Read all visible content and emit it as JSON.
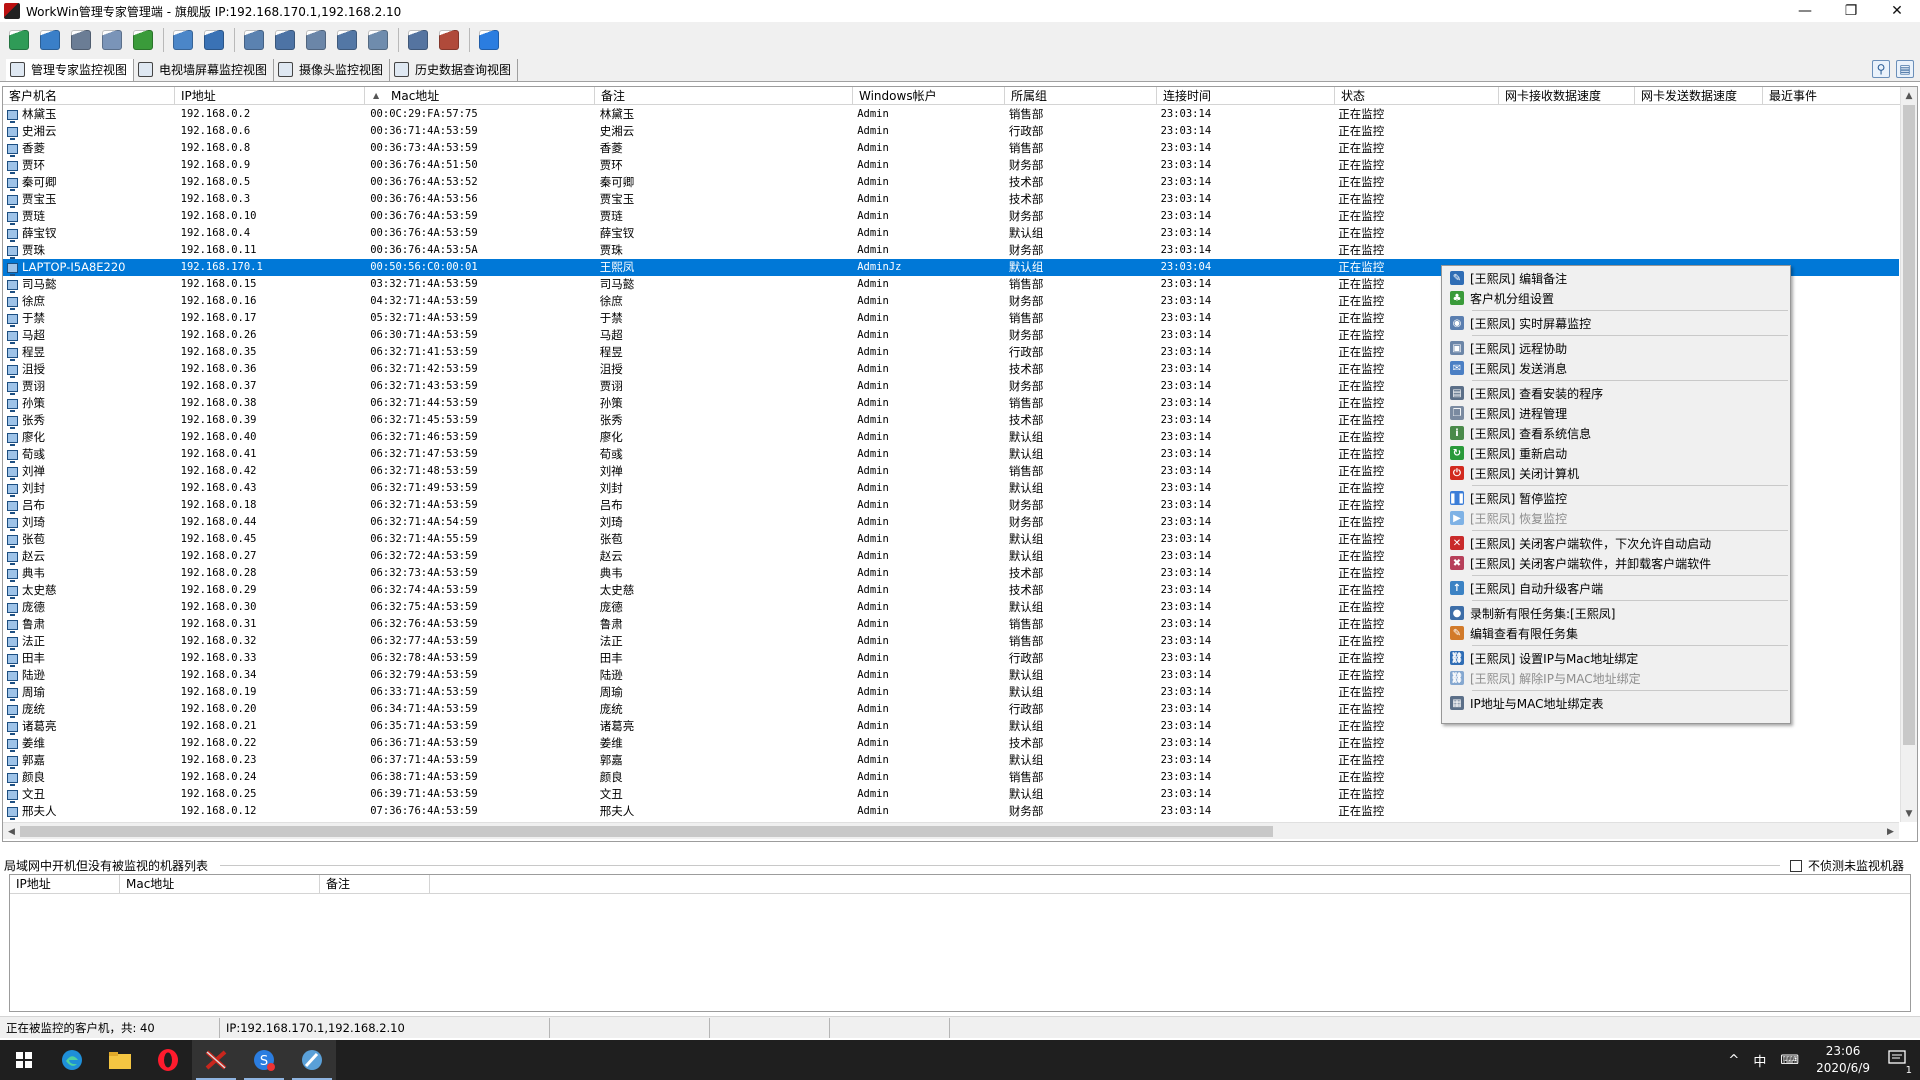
{
  "window": {
    "title": "WorkWin管理专家管理端 - 旗舰版 IP:192.168.170.1,192.168.2.10",
    "minimize": "—",
    "maximize": "❐",
    "close": "✕"
  },
  "toolbar": {
    "icons": [
      "refresh-icon",
      "globe-icon",
      "screen-monitor-icon",
      "remote-desktop-icon",
      "send-message-icon",
      "user-group-icon",
      "policy-icon",
      "multi-screen-icon",
      "process-icon",
      "camera-icon",
      "history-icon",
      "search-log-icon",
      "window-icon",
      "settings-icon",
      "help-icon"
    ]
  },
  "tabs": [
    {
      "label": "管理专家监控视图"
    },
    {
      "label": "电视墙屏幕监控视图"
    },
    {
      "label": "摄像头监控视图"
    },
    {
      "label": "历史数据查询视图"
    }
  ],
  "tab_right": {
    "search": "⚲",
    "layout": "▤"
  },
  "main_grid": {
    "columns": [
      "客户机名",
      "IP地址",
      "Mac地址",
      "备注",
      "Windows帐户",
      "所属组",
      "连接时间",
      "状态",
      "网卡接收数据速度",
      "网卡发送数据速度",
      "最近事件"
    ],
    "rows": [
      [
        "林黛玉",
        "192.168.0.2",
        "00:0C:29:FA:57:75",
        "林黛玉",
        "Admin",
        "销售部",
        "23:03:14",
        "正在监控"
      ],
      [
        "史湘云",
        "192.168.0.6",
        "00:36:71:4A:53:59",
        "史湘云",
        "Admin",
        "行政部",
        "23:03:14",
        "正在监控"
      ],
      [
        "香菱",
        "192.168.0.8",
        "00:36:73:4A:53:59",
        "香菱",
        "Admin",
        "销售部",
        "23:03:14",
        "正在监控"
      ],
      [
        "贾环",
        "192.168.0.9",
        "00:36:76:4A:51:50",
        "贾环",
        "Admin",
        "财务部",
        "23:03:14",
        "正在监控"
      ],
      [
        "秦可卿",
        "192.168.0.5",
        "00:36:76:4A:53:52",
        "秦可卿",
        "Admin",
        "技术部",
        "23:03:14",
        "正在监控"
      ],
      [
        "贾宝玉",
        "192.168.0.3",
        "00:36:76:4A:53:56",
        "贾宝玉",
        "Admin",
        "技术部",
        "23:03:14",
        "正在监控"
      ],
      [
        "贾琏",
        "192.168.0.10",
        "00:36:76:4A:53:59",
        "贾琏",
        "Admin",
        "财务部",
        "23:03:14",
        "正在监控"
      ],
      [
        "薛宝钗",
        "192.168.0.4",
        "00:36:76:4A:53:59",
        "薛宝钗",
        "Admin",
        "默认组",
        "23:03:14",
        "正在监控"
      ],
      [
        "贾珠",
        "192.168.0.11",
        "00:36:76:4A:53:5A",
        "贾珠",
        "Admin",
        "财务部",
        "23:03:14",
        "正在监控"
      ],
      [
        "LAPTOP-I5A8E220",
        "192.168.170.1",
        "00:50:56:C0:00:01",
        "王熙凤",
        "AdminJz",
        "默认组",
        "23:03:04",
        "正在监控"
      ],
      [
        "司马懿",
        "192.168.0.15",
        "03:32:71:4A:53:59",
        "司马懿",
        "Admin",
        "销售部",
        "23:03:14",
        "正在监控"
      ],
      [
        "徐庶",
        "192.168.0.16",
        "04:32:71:4A:53:59",
        "徐庶",
        "Admin",
        "财务部",
        "23:03:14",
        "正在监控"
      ],
      [
        "于禁",
        "192.168.0.17",
        "05:32:71:4A:53:59",
        "于禁",
        "Admin",
        "销售部",
        "23:03:14",
        "正在监控"
      ],
      [
        "马超",
        "192.168.0.26",
        "06:30:71:4A:53:59",
        "马超",
        "Admin",
        "财务部",
        "23:03:14",
        "正在监控"
      ],
      [
        "程昱",
        "192.168.0.35",
        "06:32:71:41:53:59",
        "程昱",
        "Admin",
        "行政部",
        "23:03:14",
        "正在监控"
      ],
      [
        "沮授",
        "192.168.0.36",
        "06:32:71:42:53:59",
        "沮授",
        "Admin",
        "技术部",
        "23:03:14",
        "正在监控"
      ],
      [
        "贾诩",
        "192.168.0.37",
        "06:32:71:43:53:59",
        "贾诩",
        "Admin",
        "财务部",
        "23:03:14",
        "正在监控"
      ],
      [
        "孙策",
        "192.168.0.38",
        "06:32:71:44:53:59",
        "孙策",
        "Admin",
        "销售部",
        "23:03:14",
        "正在监控"
      ],
      [
        "张秀",
        "192.168.0.39",
        "06:32:71:45:53:59",
        "张秀",
        "Admin",
        "技术部",
        "23:03:14",
        "正在监控"
      ],
      [
        "廖化",
        "192.168.0.40",
        "06:32:71:46:53:59",
        "廖化",
        "Admin",
        "默认组",
        "23:03:14",
        "正在监控"
      ],
      [
        "荀彧",
        "192.168.0.41",
        "06:32:71:47:53:59",
        "荀彧",
        "Admin",
        "默认组",
        "23:03:14",
        "正在监控"
      ],
      [
        "刘禅",
        "192.168.0.42",
        "06:32:71:48:53:59",
        "刘禅",
        "Admin",
        "销售部",
        "23:03:14",
        "正在监控"
      ],
      [
        "刘封",
        "192.168.0.43",
        "06:32:71:49:53:59",
        "刘封",
        "Admin",
        "默认组",
        "23:03:14",
        "正在监控"
      ],
      [
        "吕布",
        "192.168.0.18",
        "06:32:71:4A:53:59",
        "吕布",
        "Admin",
        "财务部",
        "23:03:14",
        "正在监控"
      ],
      [
        "刘琦",
        "192.168.0.44",
        "06:32:71:4A:54:59",
        "刘琦",
        "Admin",
        "财务部",
        "23:03:14",
        "正在监控"
      ],
      [
        "张苞",
        "192.168.0.45",
        "06:32:71:4A:55:59",
        "张苞",
        "Admin",
        "默认组",
        "23:03:14",
        "正在监控"
      ],
      [
        "赵云",
        "192.168.0.27",
        "06:32:72:4A:53:59",
        "赵云",
        "Admin",
        "默认组",
        "23:03:14",
        "正在监控"
      ],
      [
        "典韦",
        "192.168.0.28",
        "06:32:73:4A:53:59",
        "典韦",
        "Admin",
        "技术部",
        "23:03:14",
        "正在监控"
      ],
      [
        "太史慈",
        "192.168.0.29",
        "06:32:74:4A:53:59",
        "太史慈",
        "Admin",
        "技术部",
        "23:03:14",
        "正在监控"
      ],
      [
        "庞德",
        "192.168.0.30",
        "06:32:75:4A:53:59",
        "庞德",
        "Admin",
        "默认组",
        "23:03:14",
        "正在监控"
      ],
      [
        "鲁肃",
        "192.168.0.31",
        "06:32:76:4A:53:59",
        "鲁肃",
        "Admin",
        "销售部",
        "23:03:14",
        "正在监控"
      ],
      [
        "法正",
        "192.168.0.32",
        "06:32:77:4A:53:59",
        "法正",
        "Admin",
        "销售部",
        "23:03:14",
        "正在监控"
      ],
      [
        "田丰",
        "192.168.0.33",
        "06:32:78:4A:53:59",
        "田丰",
        "Admin",
        "行政部",
        "23:03:14",
        "正在监控"
      ],
      [
        "陆逊",
        "192.168.0.34",
        "06:32:79:4A:53:59",
        "陆逊",
        "Admin",
        "默认组",
        "23:03:14",
        "正在监控"
      ],
      [
        "周瑜",
        "192.168.0.19",
        "06:33:71:4A:53:59",
        "周瑜",
        "Admin",
        "默认组",
        "23:03:14",
        "正在监控"
      ],
      [
        "庞统",
        "192.168.0.20",
        "06:34:71:4A:53:59",
        "庞统",
        "Admin",
        "行政部",
        "23:03:14",
        "正在监控"
      ],
      [
        "诸葛亮",
        "192.168.0.21",
        "06:35:71:4A:53:59",
        "诸葛亮",
        "Admin",
        "默认组",
        "23:03:14",
        "正在监控"
      ],
      [
        "姜维",
        "192.168.0.22",
        "06:36:71:4A:53:59",
        "姜维",
        "Admin",
        "技术部",
        "23:03:14",
        "正在监控"
      ],
      [
        "郭嘉",
        "192.168.0.23",
        "06:37:71:4A:53:59",
        "郭嘉",
        "Admin",
        "默认组",
        "23:03:14",
        "正在监控"
      ],
      [
        "颜良",
        "192.168.0.24",
        "06:38:71:4A:53:59",
        "颜良",
        "Admin",
        "销售部",
        "23:03:14",
        "正在监控"
      ],
      [
        "文丑",
        "192.168.0.25",
        "06:39:71:4A:53:59",
        "文丑",
        "Admin",
        "默认组",
        "23:03:14",
        "正在监控"
      ],
      [
        "邢夫人",
        "192.168.0.12",
        "07:36:76:4A:53:59",
        "邢夫人",
        "Admin",
        "财务部",
        "23:03:14",
        "正在监控"
      ]
    ],
    "selected_index": 9,
    "scroll_up": "▲",
    "scroll_down": "▼",
    "scroll_left": "◀",
    "scroll_right": "▶"
  },
  "context_menu": [
    {
      "label": "[王熙凤] 编辑备注",
      "icon": "edit-note-icon",
      "color": "#2f6db5",
      "glyph": "✎"
    },
    {
      "label": "客户机分组设置",
      "icon": "group-settings-icon",
      "color": "#3a9b3a",
      "glyph": "♣"
    },
    {
      "sep": true
    },
    {
      "label": "[王熙凤] 实时屏幕监控",
      "icon": "screen-monitor-icon",
      "color": "#5b7fb0",
      "glyph": "◉"
    },
    {
      "sep": true
    },
    {
      "label": "[王熙凤] 远程协助",
      "icon": "remote-assist-icon",
      "color": "#6c86a8",
      "glyph": "▣"
    },
    {
      "label": "[王熙凤] 发送消息",
      "icon": "send-message-icon",
      "color": "#4b7fc4",
      "glyph": "✉"
    },
    {
      "sep": true
    },
    {
      "label": "[王熙凤] 查看安装的程序",
      "icon": "installed-programs-icon",
      "color": "#5b6f88",
      "glyph": "▤"
    },
    {
      "label": "[王熙凤] 进程管理",
      "icon": "process-icon",
      "color": "#7a8aa0",
      "glyph": "❐"
    },
    {
      "label": "[王熙凤] 查看系统信息",
      "icon": "system-info-icon",
      "color": "#4a8a4a",
      "glyph": "i"
    },
    {
      "label": "[王熙凤] 重新启动",
      "icon": "restart-icon",
      "color": "#2a9a3a",
      "glyph": "↻"
    },
    {
      "label": "[王熙凤] 关闭计算机",
      "icon": "power-icon",
      "color": "#d22a1e",
      "glyph": "⏻"
    },
    {
      "sep": true
    },
    {
      "label": "[王熙凤] 暂停监控",
      "icon": "pause-icon",
      "color": "#3b7dd8",
      "glyph": "❚❚"
    },
    {
      "label": "[王熙凤] 恢复监控",
      "icon": "play-icon",
      "color": "#7fb2e5",
      "glyph": "▶",
      "disabled": true
    },
    {
      "sep": true
    },
    {
      "label": "[王熙凤] 关闭客户端软件，下次允许自动启动",
      "icon": "close-client-icon",
      "color": "#c92a2a",
      "glyph": "✕"
    },
    {
      "label": "[王熙凤] 关闭客户端软件，并卸载客户端软件",
      "icon": "uninstall-client-icon",
      "color": "#b7405a",
      "glyph": "✖"
    },
    {
      "sep": true
    },
    {
      "label": "[王熙凤] 自动升级客户端",
      "icon": "upgrade-icon",
      "color": "#3b82c4",
      "glyph": "↑"
    },
    {
      "sep": true
    },
    {
      "label": "录制新有限任务集:[王熙凤]",
      "icon": "record-task-icon",
      "color": "#3d6ea8",
      "glyph": "●"
    },
    {
      "label": "编辑查看有限任务集",
      "icon": "edit-task-icon",
      "color": "#d27a2a",
      "glyph": "✎"
    },
    {
      "sep": true
    },
    {
      "label": "[王熙凤] 设置IP与Mac地址绑定",
      "icon": "bind-ip-mac-icon",
      "color": "#2f6db5",
      "glyph": "⛓"
    },
    {
      "label": "[王熙凤] 解除IP与MAC地址绑定",
      "icon": "unbind-ip-mac-icon",
      "color": "#86a8d0",
      "glyph": "⛓",
      "disabled": true
    },
    {
      "sep": true
    },
    {
      "label": "IP地址与MAC地址绑定表",
      "icon": "binding-table-icon",
      "color": "#5b6f88",
      "glyph": "▦"
    }
  ],
  "panel2": {
    "title": "局域网中开机但没有被监视的机器列表",
    "checkbox_label": "不侦测未监视机器",
    "columns": [
      "IP地址",
      "Mac地址",
      "备注"
    ]
  },
  "statusbar": {
    "count": "正在被监控的客户机，共: 40",
    "ip": "IP:192.168.170.1,192.168.2.10"
  },
  "taskbar": {
    "apps": [
      "start-icon",
      "edge-icon",
      "file-explorer-icon",
      "opera-icon",
      "workwin-icon",
      "sogou-icon",
      "feather-icon"
    ],
    "tray": {
      "chevron": "^",
      "ime": "中",
      "keyboard": "⌨",
      "time": "23:06",
      "date": "2020/6/9",
      "notification": "1"
    }
  }
}
